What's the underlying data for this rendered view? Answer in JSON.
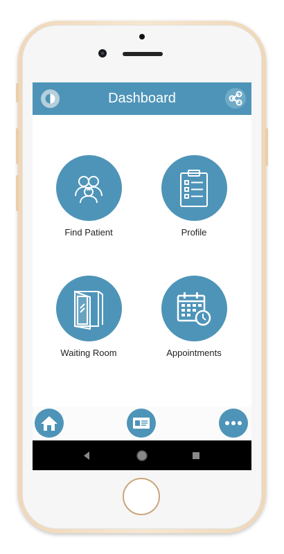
{
  "header": {
    "title": "Dashboard",
    "left_icon": "logo-icon",
    "right_icon": "share-icon"
  },
  "tiles": [
    {
      "label": "Find Patient",
      "icon": "people-icon"
    },
    {
      "label": "Profile",
      "icon": "clipboard-icon"
    },
    {
      "label": "Waiting Room",
      "icon": "door-icon"
    },
    {
      "label": "Appointments",
      "icon": "calendar-clock-icon"
    }
  ],
  "bottom_nav": [
    {
      "icon": "home-icon"
    },
    {
      "icon": "id-card-icon"
    },
    {
      "icon": "more-icon"
    }
  ],
  "android_nav": [
    {
      "icon": "back-icon"
    },
    {
      "icon": "home-circle-icon"
    },
    {
      "icon": "recent-apps-icon"
    }
  ],
  "colors": {
    "accent": "#4e94b8",
    "header_bg": "#4e94b8",
    "phone_frame": "#efd7b8"
  }
}
